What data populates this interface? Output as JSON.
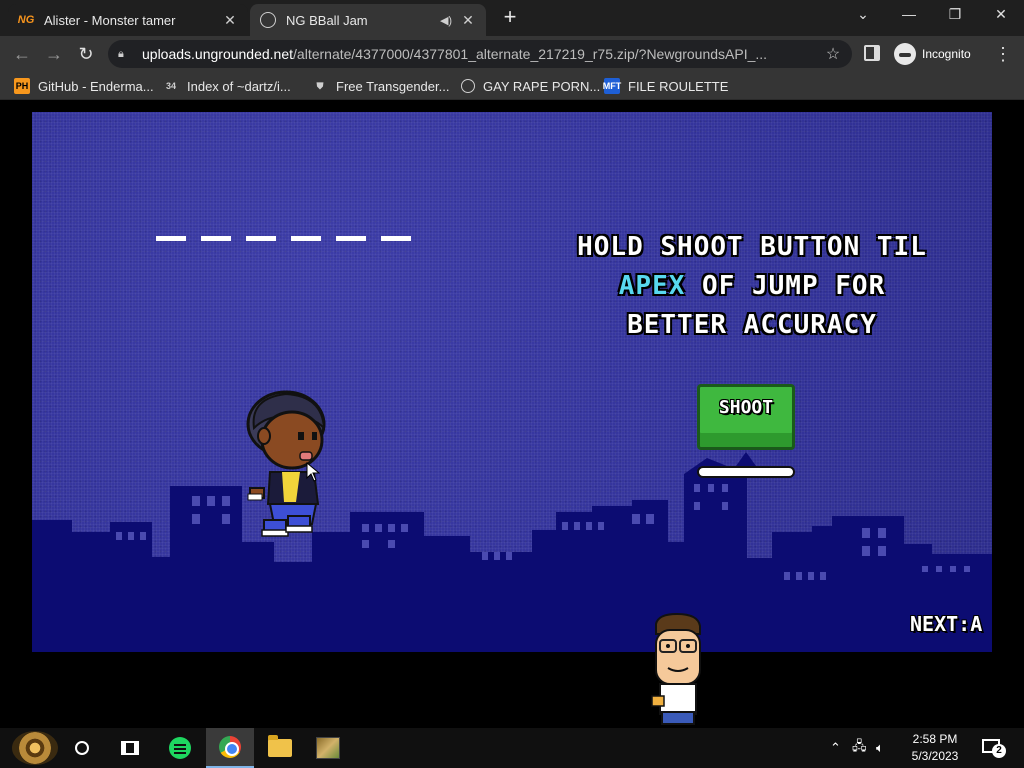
{
  "browser": {
    "tabs": [
      {
        "title": "Alister - Monster tamer",
        "favicon": "NG",
        "active": false
      },
      {
        "title": "NG BBall Jam",
        "favicon": "globe-icon",
        "active": true,
        "audio": true
      }
    ],
    "new_tab_label": "+",
    "address": {
      "host": "uploads.ungrounded.net",
      "path": "/alternate/4377000/4377801_alternate_217219_r75.zip/?NewgroundsAPI_..."
    },
    "profile_label": "Incognito",
    "bookmarks": [
      {
        "label": "GitHub - Enderma...",
        "icon": "PH"
      },
      {
        "label": "Index of ~dartz/i...",
        "icon": "34"
      },
      {
        "label": "Free Transgender...",
        "icon": "shield-icon"
      },
      {
        "label": "GAY RAPE PORN...",
        "icon": "globe-icon"
      },
      {
        "label": "FILE ROULETTE",
        "icon": "MFT"
      }
    ]
  },
  "game": {
    "word_slot_count": 6,
    "hint": {
      "line1": "HOLD SHOOT BUTTON TIL",
      "apex": "APEX",
      "line2_rest": " OF JUMP FOR",
      "line3": "BETTER ACCURACY"
    },
    "shoot_label": "SHOOT",
    "next_label": "NEXT:A",
    "colors": {
      "sky": "#33339a",
      "skyline": "#0c0c72",
      "apex_text": "#58d8ef",
      "shoot_button": "#3fb83f"
    }
  },
  "taskbar": {
    "apps": [
      "start-orb",
      "search-circle",
      "task-view",
      "green-app",
      "chrome",
      "file-explorer",
      "game-app"
    ],
    "clock_time": "2:58 PM",
    "clock_date": "5/3/2023",
    "notification_count": "2"
  }
}
